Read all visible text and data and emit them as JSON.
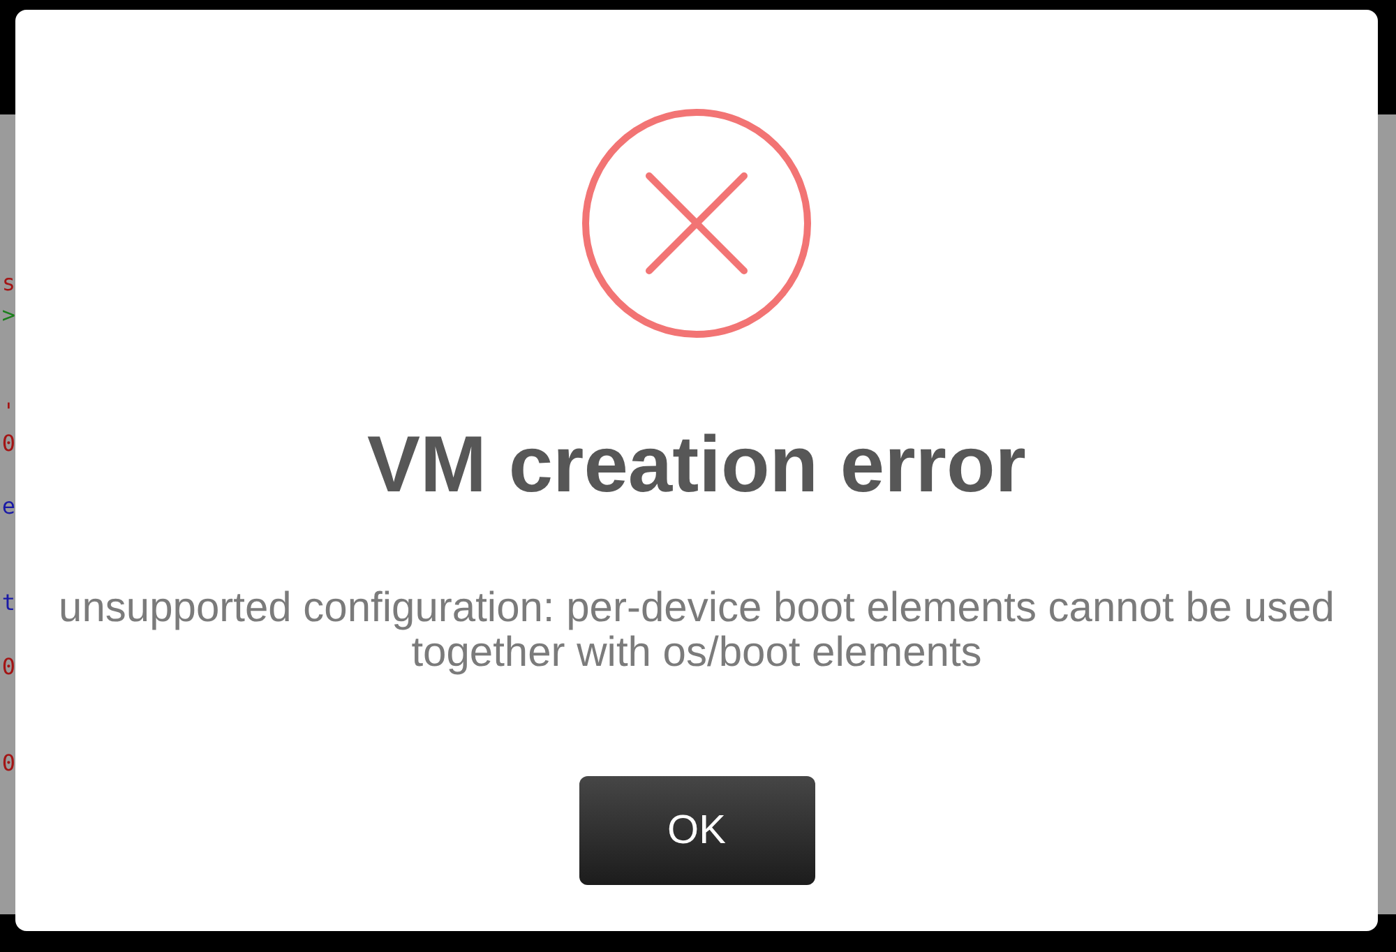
{
  "background": {
    "code_fragments": [
      {
        "text": "s",
        "color": "#a31515"
      },
      {
        "text": ">",
        "color": "#1a7f1a"
      },
      {
        "text": "'",
        "color": "#a31515"
      },
      {
        "text": "0",
        "color": "#a31515"
      },
      {
        "text": "e",
        "color": "#1a1aa6"
      },
      {
        "text": "t",
        "color": "#1a1aa6"
      },
      {
        "text": "0",
        "color": "#a31515"
      },
      {
        "text": "0",
        "color": "#a31515"
      }
    ]
  },
  "dialog": {
    "title": "VM creation error",
    "message": "unsupported configuration: per-device boot elements cannot be used together with os/boot elements",
    "confirm_button": "OK"
  }
}
